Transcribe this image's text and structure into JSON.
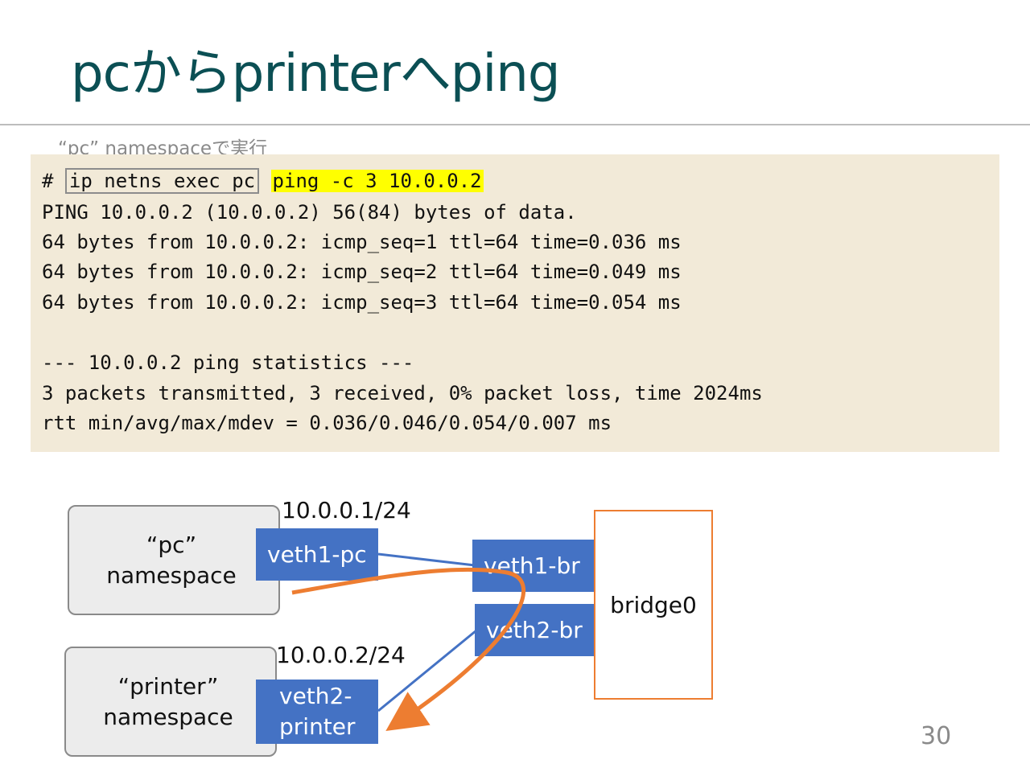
{
  "slide": {
    "title": "pcからprinterへping",
    "caption": "“pc” namespaceで実行",
    "page_number": "30"
  },
  "terminal": {
    "prompt": "#",
    "command_boxed": "ip netns exec pc",
    "command_highlight": "ping -c 3 10.0.0.2",
    "output": [
      "PING 10.0.0.2 (10.0.0.2) 56(84) bytes of data.",
      "64 bytes from 10.0.0.2: icmp_seq=1 ttl=64 time=0.036 ms",
      "64 bytes from 10.0.0.2: icmp_seq=2 ttl=64 time=0.049 ms",
      "64 bytes from 10.0.0.2: icmp_seq=3 ttl=64 time=0.054 ms",
      "",
      "--- 10.0.0.2 ping statistics ---",
      "3 packets transmitted, 3 received, 0% packet loss, time 2024ms",
      "rtt min/avg/max/mdev = 0.036/0.046/0.054/0.007 ms"
    ],
    "background": "#f2ead8",
    "highlight_color": "#ffff00"
  },
  "diagram": {
    "pc_namespace": "“pc”\nnamespace",
    "printer_namespace": "“printer”\nnamespace",
    "veth1_pc": "veth1-pc",
    "veth2_printer": "veth2-\nprinter",
    "veth1_br": "veth1-br",
    "veth2_br": "veth2-br",
    "bridge": "bridge0",
    "pc_ip": "10.0.0.1/24",
    "printer_ip": "10.0.0.2/24",
    "interface_color": "#4472c4",
    "link_color": "#4472c4",
    "arrow_color": "#ed7d31"
  }
}
